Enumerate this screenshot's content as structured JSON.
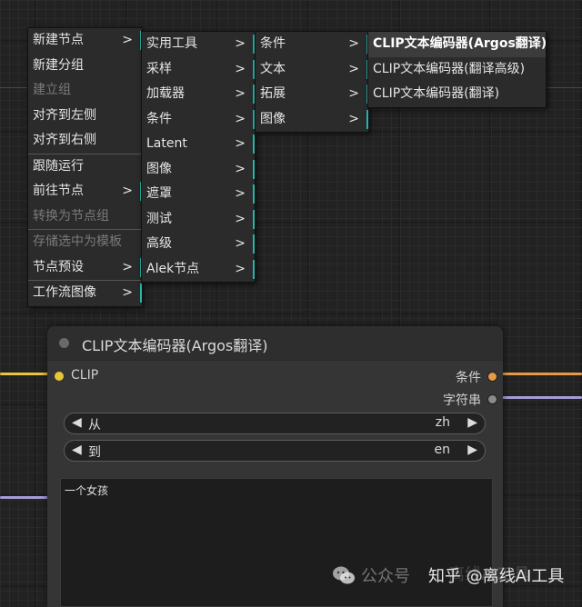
{
  "context_menu": {
    "items": [
      {
        "label": "新建节点",
        "arrow": ">",
        "disabled": false,
        "submenu": true
      },
      {
        "label": "新建分组",
        "disabled": false
      },
      {
        "label": "建立组",
        "disabled": true
      },
      {
        "label": "对齐到左侧",
        "disabled": false
      },
      {
        "label": "对齐到右侧",
        "disabled": false
      },
      {
        "label": "跟随运行",
        "disabled": false
      },
      {
        "label": "前往节点",
        "arrow": ">",
        "disabled": false,
        "submenu": true
      },
      {
        "label": "转换为节点组",
        "disabled": true
      },
      {
        "label": "存储选中为模板",
        "disabled": true
      },
      {
        "label": "节点预设",
        "arrow": ">",
        "disabled": false,
        "submenu": true
      },
      {
        "label": "工作流图像",
        "arrow": ">",
        "disabled": false,
        "submenu": true
      }
    ]
  },
  "submenu_categories": {
    "items": [
      {
        "label": "实用工具",
        "arrow": ">"
      },
      {
        "label": "采样",
        "arrow": ">"
      },
      {
        "label": "加载器",
        "arrow": ">"
      },
      {
        "label": "条件",
        "arrow": ">"
      },
      {
        "label": "Latent",
        "arrow": ">"
      },
      {
        "label": "图像",
        "arrow": ">"
      },
      {
        "label": "遮罩",
        "arrow": ">"
      },
      {
        "label": "测试",
        "arrow": ">"
      },
      {
        "label": "高级",
        "arrow": ">"
      },
      {
        "label": "Alek节点",
        "arrow": ">"
      }
    ]
  },
  "submenu_utility": {
    "items": [
      {
        "label": "条件",
        "arrow": ">"
      },
      {
        "label": "文本",
        "arrow": ">"
      },
      {
        "label": "拓展",
        "arrow": ">"
      },
      {
        "label": "图像",
        "arrow": ">"
      }
    ]
  },
  "submenu_condition": {
    "items": [
      {
        "label": "CLIP文本编码器(Argos翻译)",
        "highlighted": true
      },
      {
        "label": "CLIP文本编码器(翻译高级)"
      },
      {
        "label": "CLIP文本编码器(翻译)"
      }
    ]
  },
  "node": {
    "title": "CLIP文本编码器(Argos翻译)",
    "input_label": "CLIP",
    "output_conditioning": "条件",
    "output_string": "字符串",
    "widget_from": {
      "left_arrow": "◀",
      "label": "从",
      "value": "zh",
      "right_arrow": "▶"
    },
    "widget_to": {
      "left_arrow": "◀",
      "label": "到",
      "value": "en",
      "right_arrow": "▶"
    },
    "text_value": "一个女孩"
  },
  "colors": {
    "accent_teal": "#26b5a8",
    "slot_clip": "#e8c53a",
    "slot_conditioning": "#e59a45",
    "slot_string": "#a89bd6"
  },
  "watermark": {
    "text1": "公众号",
    "text2": "离线AI工具",
    "text3": "知乎 @离线AI工具"
  }
}
